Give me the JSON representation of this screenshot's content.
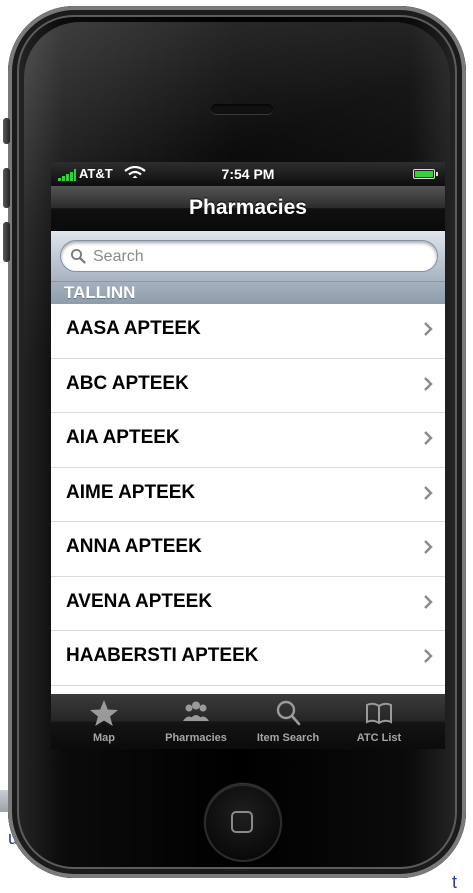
{
  "background": {
    "left_fragment": "u",
    "right_fragment": "t"
  },
  "status_bar": {
    "carrier": "AT&T",
    "time": "7:54 PM"
  },
  "nav_bar": {
    "title": "Pharmacies"
  },
  "search": {
    "placeholder": "Search"
  },
  "section": {
    "header": "TALLINN"
  },
  "list": {
    "items": [
      {
        "label": "AASA APTEEK"
      },
      {
        "label": "ABC APTEEK"
      },
      {
        "label": "AIA APTEEK"
      },
      {
        "label": "AIME APTEEK"
      },
      {
        "label": "ANNA APTEEK"
      },
      {
        "label": "AVENA APTEEK"
      },
      {
        "label": "HAABERSTI APTEEK"
      }
    ]
  },
  "tab_bar": {
    "tabs": [
      {
        "label": "Map",
        "icon": "star-icon"
      },
      {
        "label": "Pharmacies",
        "icon": "people-icon"
      },
      {
        "label": "Item Search",
        "icon": "magnifier-icon"
      },
      {
        "label": "ATC List",
        "icon": "book-icon"
      }
    ]
  },
  "colors": {
    "signal": "#2fd13a",
    "battery": "#35d33a",
    "section_header": "#9aa7b5",
    "page_text_blue": "#2a35a8"
  }
}
